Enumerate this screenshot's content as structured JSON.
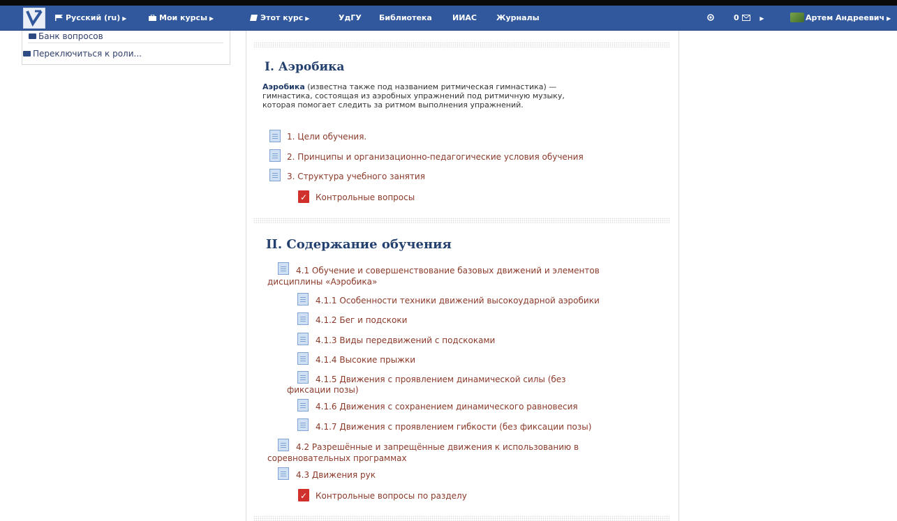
{
  "navbar": {
    "language": "Русский (ru)",
    "my_courses": "Мои курсы",
    "this_course": "Этот курс",
    "links": [
      "УдГУ",
      "Библиотека",
      "ИИАС",
      "Журналы"
    ],
    "messages_count": "0",
    "user_name": "Артем Андреевич"
  },
  "sidebar": {
    "items": [
      {
        "label": "Банк вопросов"
      },
      {
        "label": "Переключиться к роли..."
      }
    ]
  },
  "sections": [
    {
      "title": "I. Аэробика",
      "summary_bold": "Аэробика",
      "summary_rest_line1": " (известна также под названием ритмическая гимнастика) —",
      "summary_line2": "гимнастика, состоящая из аэробных упражнений под ритмичную музыку,",
      "summary_line3": "которая помогает следить за ритмом выполнения упражнений.",
      "activities": [
        {
          "label": "1. Цели обучения."
        },
        {
          "label": "2. Принципы и организационно-педагогические условия обучения"
        },
        {
          "label": "3. Структура учебного занятия"
        },
        {
          "label": "Контрольные вопросы"
        }
      ]
    },
    {
      "title": "II. Содержание обучения",
      "activities": [
        {
          "label_line1": "4.1 Обучение и совершенствование базовых движений и элементов",
          "label_line2": "дисциплины «Аэробика»"
        },
        {
          "label": "4.1.1 Особенности техники движений высокоударной аэробики"
        },
        {
          "label": "4.1.2 Бег и подскоки"
        },
        {
          "label": "4.1.3 Виды передвижений с подскоками"
        },
        {
          "label": "4.1.4 Высокие прыжки"
        },
        {
          "label_line1": "4.1.5 Движения с проявлением динамической силы (без",
          "label_line2": "фиксации позы)"
        },
        {
          "label": "4.1.6 Движения с сохранением динамического равновесия"
        },
        {
          "label": "4.1.7 Движения с проявлением гибкости (без фиксации позы)"
        },
        {
          "label_line1": "4.2 Разрешённые и запрещённые движения к использованию в",
          "label_line2": "соревновательных программах"
        },
        {
          "label": "4.3 Движения рук"
        },
        {
          "label": "Контрольные вопросы по разделу"
        }
      ]
    }
  ]
}
